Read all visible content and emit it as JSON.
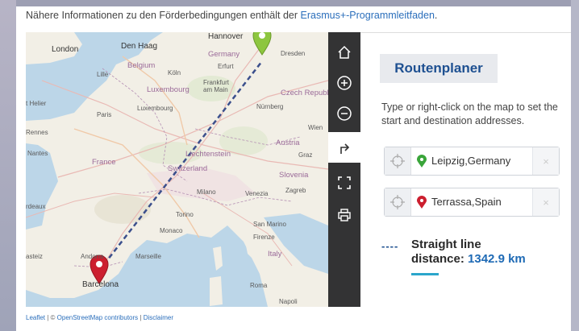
{
  "intro": {
    "prefix": "Nähere Informationen zu den Förderbedingungen enthält der ",
    "link": "Erasmus+-Programmleitfaden",
    "suffix": "."
  },
  "map": {
    "labels": {
      "london": "London",
      "den_haag": "Den Haag",
      "hannover": "Hannover",
      "dresden": "Dresden",
      "belgium": "Belgium",
      "koln": "Köln",
      "erfurt": "Erfurt",
      "germany": "Germany",
      "lille": "Lille",
      "luxembourg_country": "Luxembourg",
      "frankfurt": "Frankfurt\nam Main",
      "czech": "Czech Republ",
      "st_helier": "t Helier",
      "paris": "Paris",
      "luxembourg_city": "Luxembourg",
      "nurnberg": "Nürnberg",
      "rennes": "Rennes",
      "wien": "Wien",
      "austria": "Austria",
      "nantes": "Nantes",
      "france": "France",
      "liechtenstein": "Liechtenstein",
      "graz": "Graz",
      "switzerland": "Switzerland",
      "slovenia": "Slovenia",
      "milano": "Milano",
      "venezia": "Venezia",
      "zagreb": "Zagreb",
      "bordeaux": "rdeaux",
      "torino": "Torino",
      "monaco": "Monaco",
      "san_marino": "San Marino",
      "firenze": "Firenze",
      "italy": "Italy",
      "andorra": "Andorra",
      "marseille": "Marseille",
      "barcelona": "Barcelona",
      "roma": "Roma",
      "napoli": "Napoli",
      "asteiz": "asteiz"
    },
    "start_pin_color": "#8dc63f",
    "end_pin_color": "#cc1f2f",
    "route_color": "#3b4f8c"
  },
  "toolbar": {
    "home": "home-icon",
    "zoom_in": "zoom-in-icon",
    "zoom_out": "zoom-out-icon",
    "route": "route-icon",
    "fullscreen": "fullscreen-icon",
    "print": "print-icon"
  },
  "panel": {
    "title": "Routenplaner",
    "hint": "Type or right-click on the map to set the start and destination addresses.",
    "start_address": "Leipzig,Germany",
    "end_address": "Terrassa,Spain",
    "clear_symbol": "×",
    "legend_symbol": "----",
    "distance_label_line1": "Straight line",
    "distance_label_line2": "distance: ",
    "distance_value": "1342.9 km"
  },
  "footer": {
    "leaflet": "Leaflet",
    "sep1": " | © ",
    "osm": "OpenStreetMap contributors",
    "sep2": " | ",
    "disclaimer": "Disclaimer"
  }
}
